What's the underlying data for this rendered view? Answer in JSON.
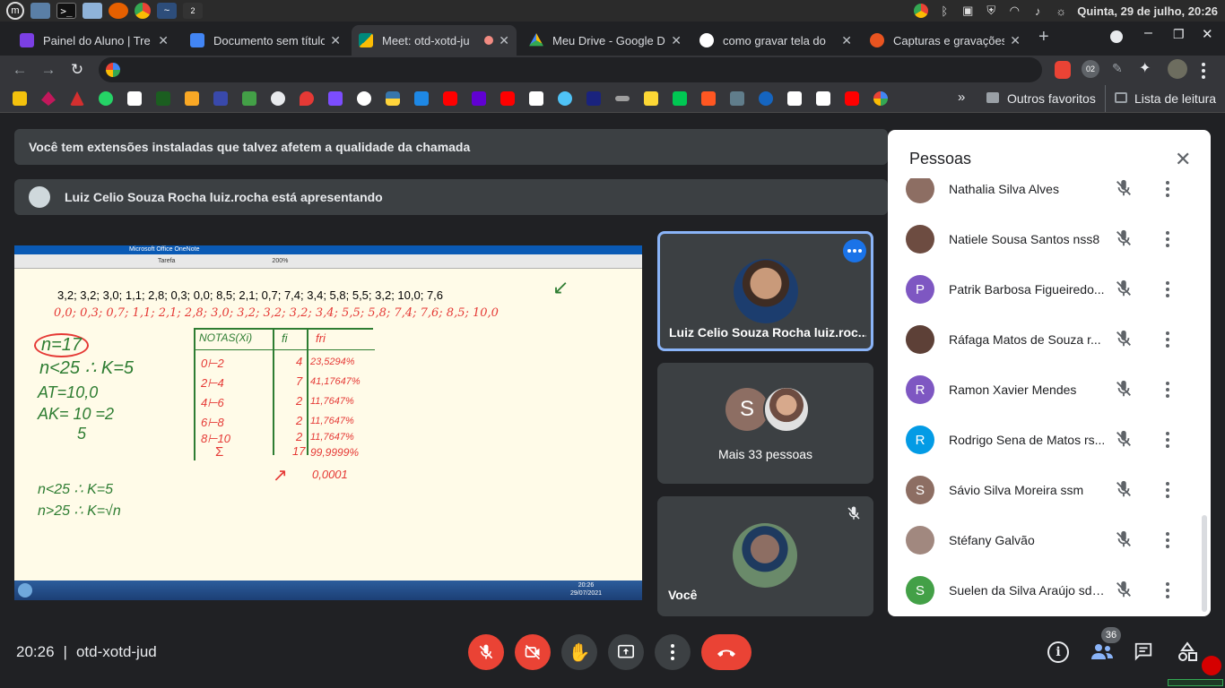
{
  "os": {
    "clock": "Quinta, 29 de julho, 20:26",
    "apps": [
      "menu-icon",
      "desktop-icon",
      "terminal-icon",
      "files-icon",
      "firefox-icon",
      "chrome-icon",
      "network-icon",
      "workspace-icon"
    ],
    "workspace_label": "2"
  },
  "tabs": [
    {
      "title": "Painel do Aluno | Tre",
      "color": "#7b3fe4"
    },
    {
      "title": "Documento sem título",
      "color": "#4285f4"
    },
    {
      "title": "Meet: otd-xotd-ju",
      "color": "#00897b"
    },
    {
      "title": "Meu Drive - Google D",
      "color": "#fbbc04"
    },
    {
      "title": "como gravar tela do",
      "color": "#ffffff"
    },
    {
      "title": "Capturas e gravações",
      "color": "#e95420"
    }
  ],
  "new_tab_label": "+",
  "bookmarks": {
    "more_label": "»",
    "other_label": "Outros favoritos",
    "reading_label": "Lista de leitura"
  },
  "profile_badge": "02",
  "banners": {
    "extensions": "Você tem extensões instaladas que talvez afetem a qualidade da chamada",
    "presenting": "Luiz Celio Souza Rocha luiz.rocha está apresentando"
  },
  "presentation": {
    "app_title": "Microsoft Office OneNote",
    "zoom": "200%",
    "toolbar_zoom_note": "Tarefa",
    "typed_data": "3,2; 3,2; 3,0; 1,1; 2,8; 0,3; 0,0; 8,5; 2,1; 0,7; 7,4; 3,4; 5,8; 5,5; 3,2; 10,0; 7,6",
    "sorted_data": "0,0; 0,3; 0,7; 1,1; 2,1; 2,8; 3,0; 3,2; 3,2; 3,2; 3,4; 5,5; 5,8; 7,4; 7,6; 8,5; 10,0",
    "notes": [
      "n=17",
      "n<25 ∴ K=5",
      "AT=10,0",
      "AK= 10 =2",
      "5",
      "n<25 ∴ K=5",
      "n>25 ∴ K=√n"
    ],
    "table_headers": [
      "NOTAS(Xi)",
      "fi",
      "fri"
    ],
    "table_rows": [
      [
        "0⊢2",
        "4",
        "23,5294%"
      ],
      [
        "2⊢4",
        "7",
        "41,17647%"
      ],
      [
        "4⊢6",
        "2",
        "11,7647%"
      ],
      [
        "6⊢8",
        "2",
        "11,7647%"
      ],
      [
        "8⊢10",
        "2",
        "11,7647%"
      ],
      [
        "Σ",
        "17",
        "99,9999%"
      ]
    ],
    "remainder": "0,0001",
    "taskbar_time": "20:26",
    "taskbar_date": "29/07/2021"
  },
  "tiles": {
    "presenter_name": "Luiz Celio Souza Rocha luiz.roc...",
    "others_label": "Mais 33 pessoas",
    "others_initial": "S",
    "self_label": "Você"
  },
  "people": {
    "title": "Pessoas",
    "list": [
      {
        "name": "Nathalia Silva Alves",
        "initial": "",
        "color": "#8d6e63"
      },
      {
        "name": "Natiele Sousa Santos nss8",
        "initial": "",
        "color": "#6d4c41"
      },
      {
        "name": "Patrik Barbosa Figueiredo...",
        "initial": "P",
        "color": "#7e57c2"
      },
      {
        "name": "Ráfaga Matos de Souza r...",
        "initial": "",
        "color": "#5d4037"
      },
      {
        "name": "Ramon Xavier Mendes",
        "initial": "R",
        "color": "#7e57c2"
      },
      {
        "name": "Rodrigo Sena de Matos rs...",
        "initial": "R",
        "color": "#039be5"
      },
      {
        "name": "Sávio Silva Moreira ssm",
        "initial": "S",
        "color": "#8d6e63"
      },
      {
        "name": "Stéfany Galvão",
        "initial": "",
        "color": "#a1887f"
      },
      {
        "name": "Suelen da Silva Araújo sds...",
        "initial": "S",
        "color": "#43a047"
      }
    ]
  },
  "bottom": {
    "time": "20:26",
    "separator": "|",
    "meeting_code": "otd-xotd-jud",
    "participant_count": "36"
  }
}
